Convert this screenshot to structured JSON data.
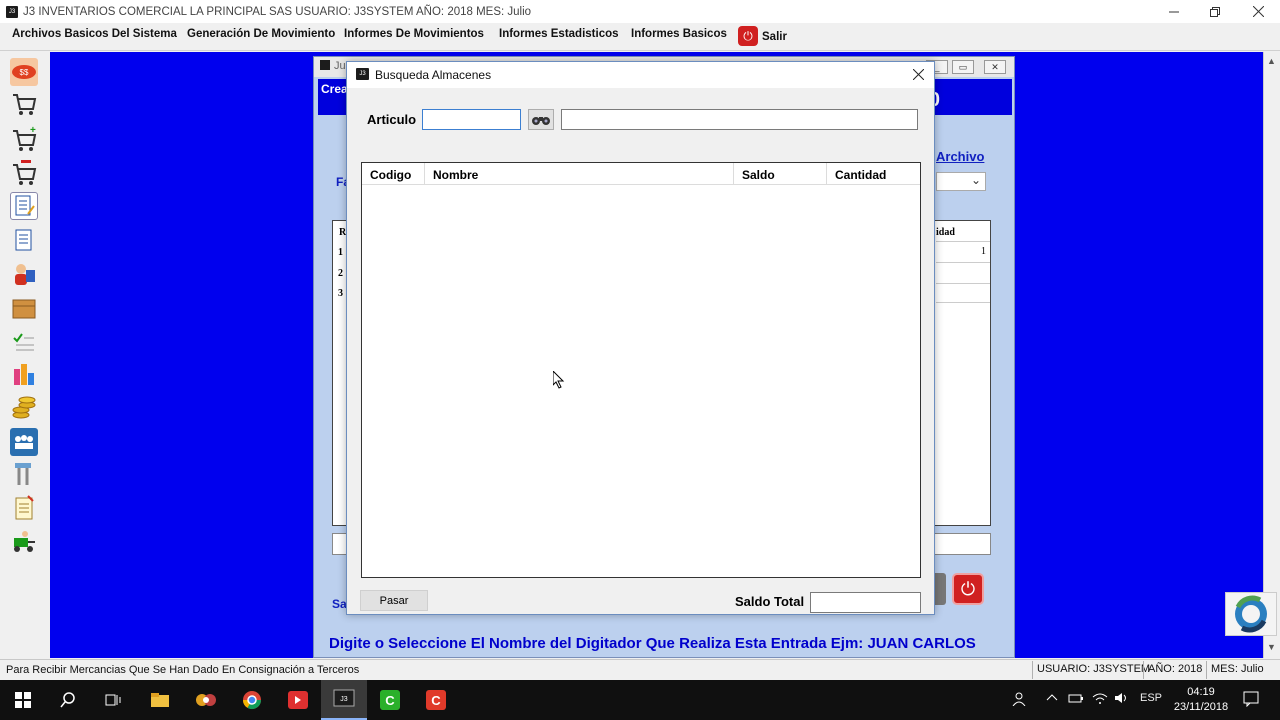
{
  "window": {
    "title": "J3 INVENTARIOS COMERCIAL LA PRINCIPAL SAS USUARIO: J3SYSTEM AÑO: 2018 MES: Julio",
    "icon_text": "J3"
  },
  "menubar": {
    "items": [
      "Archivos Basicos Del Sistema",
      "Generación De Movimiento",
      "Informes De Movimientos",
      "Informes Estadisticos",
      "Informes Basicos"
    ],
    "salir": "Salir"
  },
  "sidebar_icons": [
    "coins-icon",
    "cart-icon",
    "cart-add-icon",
    "cart-remove-icon",
    "document-edit-icon",
    "document-icon",
    "users-icon",
    "box-icon",
    "checklist-icon",
    "chart-icon",
    "money-stack-icon",
    "group-icon",
    "tools-icon",
    "notepad-icon",
    "delivery-icon"
  ],
  "background_window": {
    "title_fragment": "Ju",
    "header_text": "Crea",
    "header_number": "0",
    "archivo_link": "Archivo",
    "fa_label": "Fa",
    "grid_header_left": "R",
    "grid_header_right": "idad",
    "rows": [
      "1",
      "2",
      "3"
    ],
    "first_row_value": "1",
    "sa_label": "Sa",
    "hint": "Digite o Seleccione El Nombre del Digitador Que Realiza Esta Entrada Ejm: JUAN CARLOS"
  },
  "dialog": {
    "title": "Busqueda Almacenes",
    "articulo_label": "Articulo",
    "articulo_value": "",
    "nombre_value": "",
    "columns": [
      "Codigo",
      "Nombre",
      "Saldo",
      "Cantidad"
    ],
    "rows": [],
    "pasar_button": "Pasar",
    "saldo_total_label": "Saldo Total",
    "saldo_total_value": ""
  },
  "statusbar": {
    "message": "Para Recibir Mercancias Que Se Han Dado En Consignación a Terceros",
    "usuario": "USUARIO: J3SYSTEM",
    "anio": "AÑO: 2018",
    "mes": "MES: Julio"
  },
  "taskbar": {
    "language": "ESP",
    "time": "04:19",
    "date": "23/11/2018"
  },
  "colors": {
    "mdi_background": "#0000ee",
    "hint_text": "#0000cc",
    "power_red": "#d02020"
  }
}
